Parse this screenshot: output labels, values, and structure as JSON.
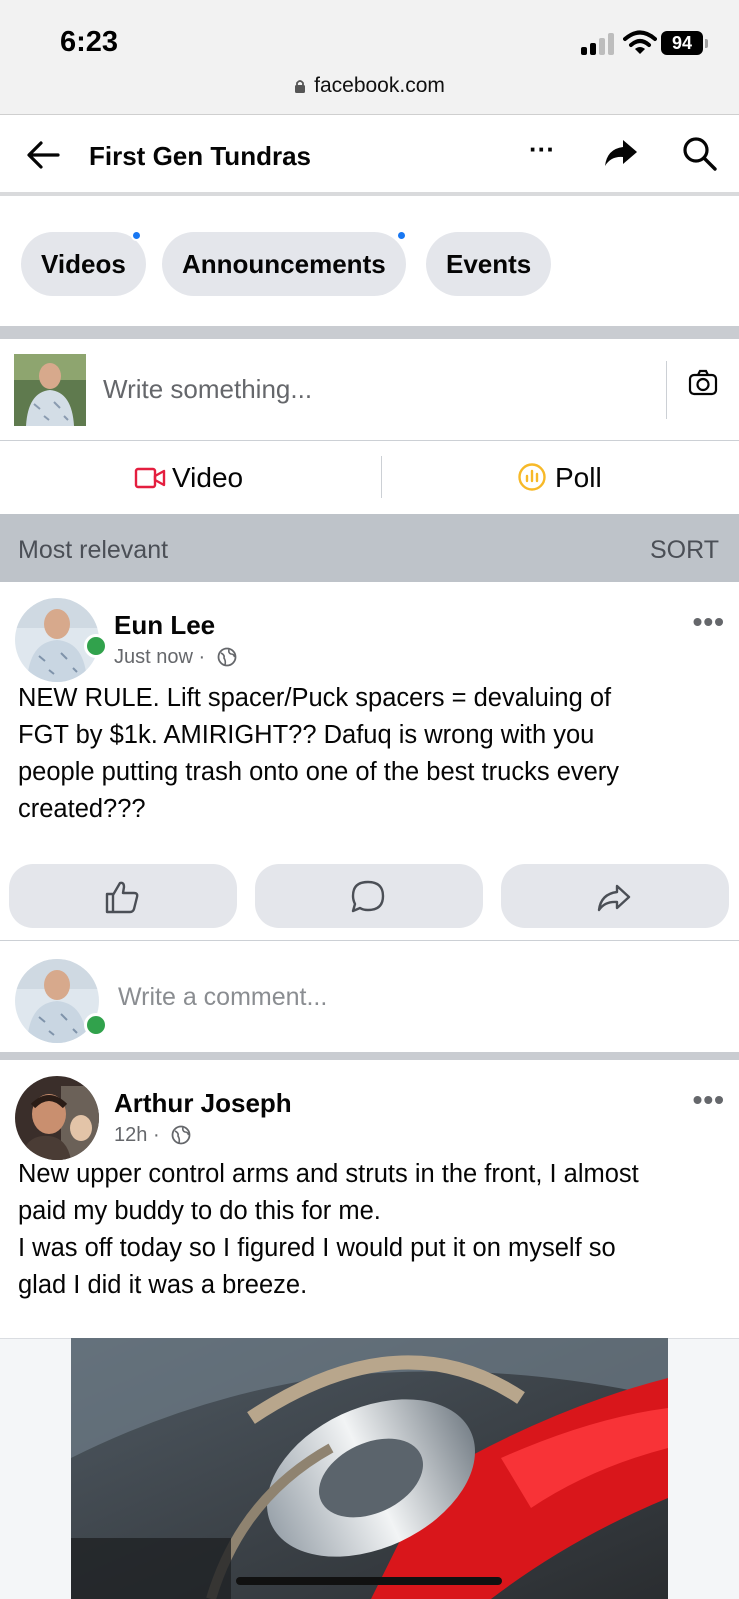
{
  "status_bar": {
    "time": "6:23",
    "battery": "94",
    "url": "facebook.com"
  },
  "header": {
    "title": "First Gen Tundras",
    "more_label": "···"
  },
  "chips": [
    {
      "label": "Videos",
      "has_dot": true
    },
    {
      "label": "Announcements",
      "has_dot": true
    },
    {
      "label": "Events",
      "has_dot": false
    }
  ],
  "composer": {
    "placeholder": "Write something..."
  },
  "composer_actions": {
    "video_label": "Video",
    "poll_label": "Poll"
  },
  "sort": {
    "left": "Most relevant",
    "right": "SORT"
  },
  "posts": [
    {
      "author": "Eun Lee",
      "time": "Just now",
      "separator": "·",
      "online": true,
      "text_lines": [
        "NEW RULE. Lift spacer/Puck spacers = devaluing of",
        "FGT by $1k. AMIRIGHT?? Dafuq is wrong with you",
        "people putting trash onto one of the best trucks every",
        "created???"
      ]
    },
    {
      "author": "Arthur Joseph",
      "time": "12h",
      "separator": "·",
      "online": false,
      "text_lines": [
        "New upper control arms and struts in the front, I almost",
        "paid my buddy to do this for me.",
        "I was off today so I figured I would put it on myself so",
        "glad I did it was a breeze."
      ]
    }
  ],
  "comment": {
    "placeholder": "Write a comment..."
  },
  "icons": {
    "back": "arrow-left-icon",
    "more": "more-icon",
    "share": "share-icon",
    "search": "search-icon",
    "camera": "camera-icon",
    "video": "video-camera-icon",
    "poll": "poll-icon",
    "like": "thumbs-up-icon",
    "comment": "comment-icon",
    "share_post": "share-arrow-icon",
    "globe": "globe-icon"
  },
  "colors": {
    "accent": "#1877f2",
    "online": "#31a24c",
    "video_icon": "#e41e3f",
    "poll_icon": "#f7b928"
  }
}
